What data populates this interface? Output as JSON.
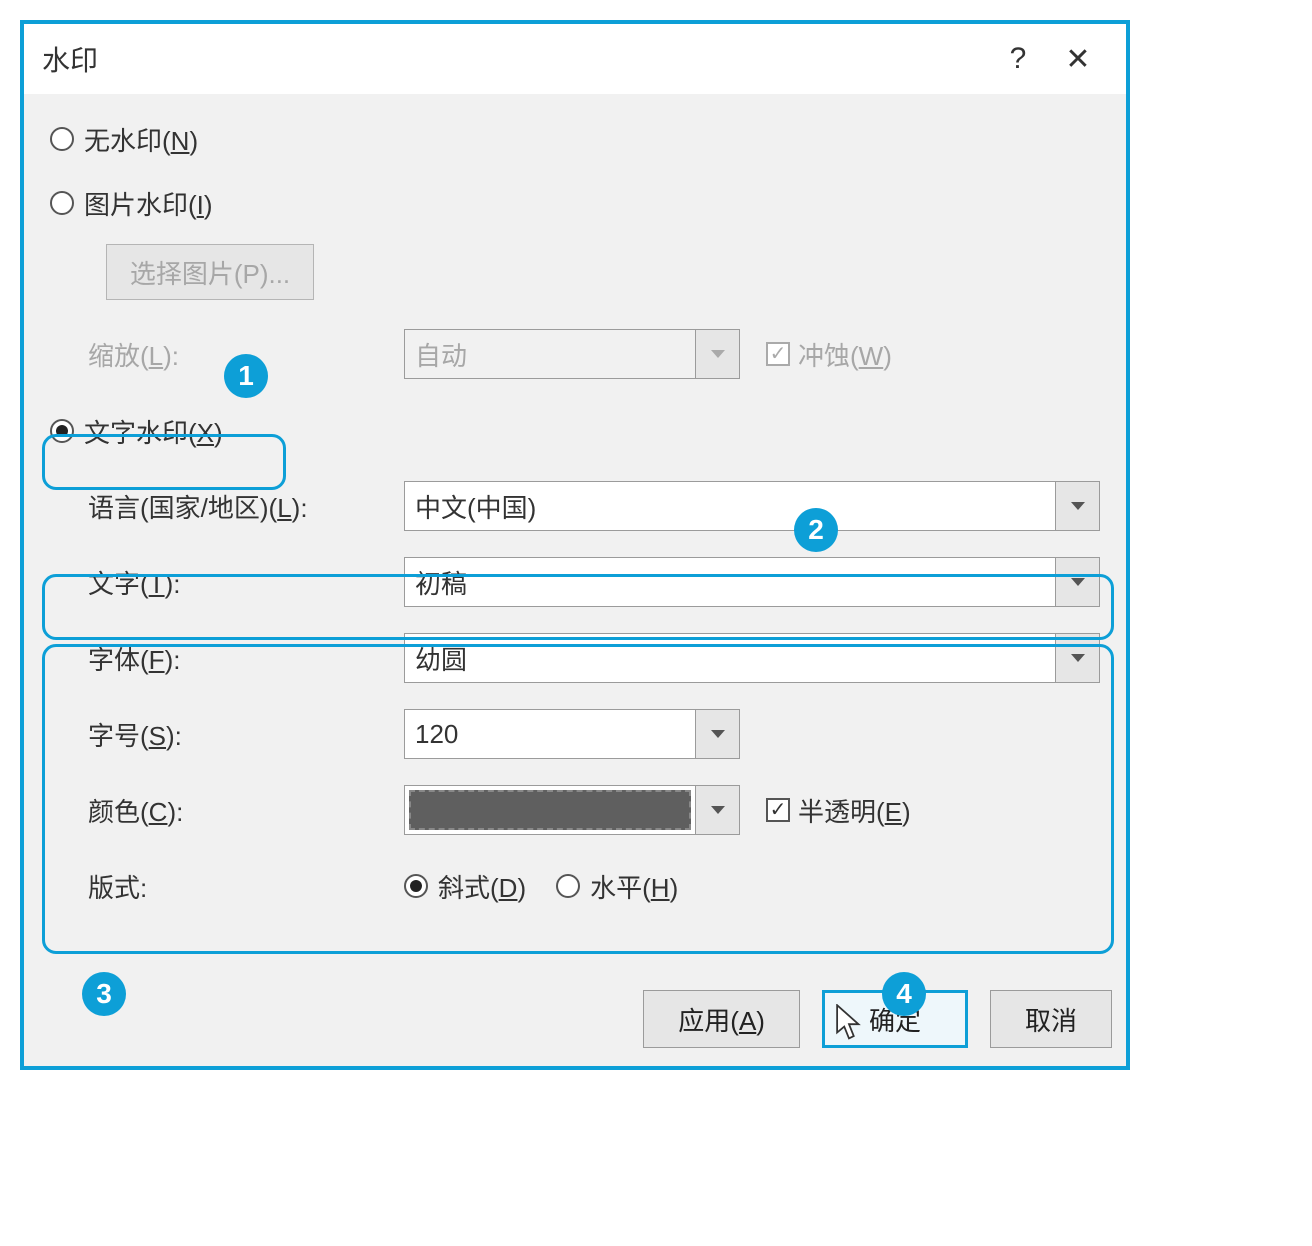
{
  "title": "水印",
  "help_icon": "?",
  "close_icon": "✕",
  "radios": {
    "none": "无水印(N)",
    "picture": "图片水印(I)",
    "text": "文字水印(X)"
  },
  "picture": {
    "select_button": "选择图片(P)...",
    "scale_label": "缩放(L):",
    "scale_value": "自动",
    "washout_label": "冲蚀(W)"
  },
  "text": {
    "language_label": "语言(国家/地区)(L):",
    "language_value": "中文(中国)",
    "text_label": "文字(T):",
    "text_value": "初稿",
    "font_label": "字体(F):",
    "font_value": "幼圆",
    "size_label": "字号(S):",
    "size_value": "120",
    "color_label": "颜色(C):",
    "semi_label": "半透明(E)",
    "layout_label": "版式:",
    "layout_diagonal": "斜式(D)",
    "layout_horizontal": "水平(H)"
  },
  "buttons": {
    "apply": "应用(A)",
    "ok": "确定",
    "cancel": "取消"
  },
  "annotations": {
    "b1": "1",
    "b2": "2",
    "b3": "3",
    "b4": "4"
  }
}
